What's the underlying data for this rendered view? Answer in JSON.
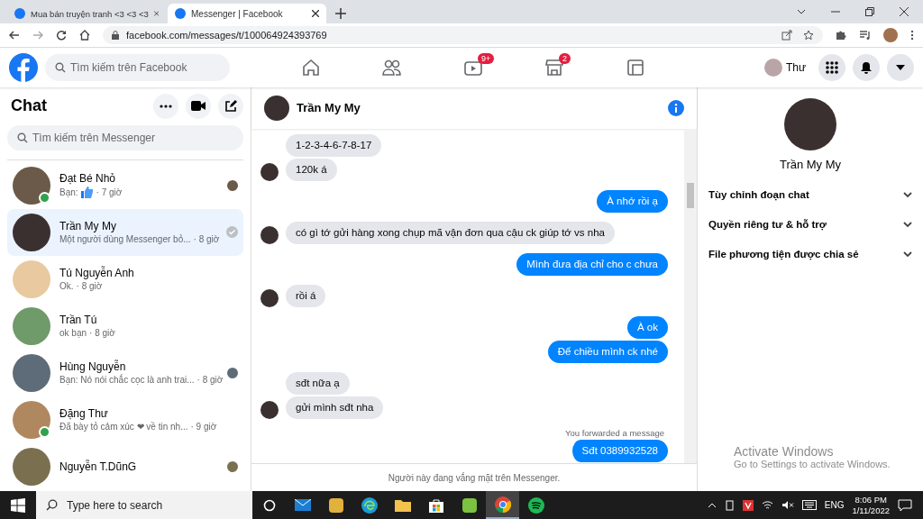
{
  "browser": {
    "tabs": [
      {
        "title": "Mua bán truyện tranh <3 <3 <3",
        "selected": false
      },
      {
        "title": "Messenger | Facebook",
        "selected": true
      }
    ],
    "url": "facebook.com/messages/t/100064924393769"
  },
  "header": {
    "search": {
      "placeholder": "Tìm kiếm trên Facebook"
    },
    "nav": [
      {
        "kind": "home"
      },
      {
        "kind": "friends"
      },
      {
        "kind": "video",
        "badge": "9+"
      },
      {
        "kind": "market",
        "badge": "2"
      },
      {
        "kind": "gaming"
      }
    ],
    "profile": "Thư"
  },
  "sidebar": {
    "title": "Chat",
    "search": {
      "placeholder": "Tìm kiếm trên Messenger"
    },
    "chats": [
      {
        "name": "Đạt Bé Nhỏ",
        "preview": "Bạn:",
        "thumbs_up": true,
        "time": "· 7 giờ",
        "online": true,
        "selected": false,
        "seen": true,
        "sent": false,
        "color": "#6b5a4a"
      },
      {
        "name": "Trần My My",
        "preview": "Một người dùng Messenger bỏ...",
        "thumbs_up": false,
        "time": "· 8 giờ",
        "online": false,
        "selected": true,
        "seen": false,
        "sent": true,
        "color": "#3b3030"
      },
      {
        "name": "Tú Nguyễn Anh",
        "preview": "Ok.",
        "thumbs_up": false,
        "time": "· 8 giờ",
        "online": false,
        "selected": false,
        "seen": false,
        "sent": false,
        "color": "#e8c9a0"
      },
      {
        "name": "Trần Tú",
        "preview": "ok bạn",
        "thumbs_up": false,
        "time": "· 8 giờ",
        "online": false,
        "selected": false,
        "seen": false,
        "sent": false,
        "color": "#6f9a6a"
      },
      {
        "name": "Hùng Nguyễn",
        "preview": "Bạn: Nó nói chắc cọc là anh trai...",
        "thumbs_up": false,
        "time": "· 8 giờ",
        "online": false,
        "selected": false,
        "seen": true,
        "sent": false,
        "color": "#5d6c78"
      },
      {
        "name": "Đặng Thư",
        "preview": "Đã bày tỏ cảm xúc ❤ về tin nh...",
        "thumbs_up": false,
        "time": "· 9 giờ",
        "online": true,
        "selected": false,
        "seen": false,
        "sent": false,
        "color": "#b08860"
      },
      {
        "name": "Nguyễn T.DũnG",
        "thumbs_up": false,
        "online": false,
        "selected": false,
        "seen": true,
        "sent": false,
        "color": "#7a7050"
      }
    ]
  },
  "conversation": {
    "name": "Trần My My",
    "messages": [
      {
        "kind": "in",
        "text": "1-2-3-4-6-7-8-17",
        "avatar": false
      },
      {
        "kind": "in",
        "text": "120k á",
        "avatar": true
      },
      {
        "kind": "out",
        "text": "À nhớ rồi ạ"
      },
      {
        "kind": "in",
        "text": "có gì tớ gửi hàng xong chụp mã vận đơn qua cậu ck giúp tớ vs nha",
        "avatar": true
      },
      {
        "kind": "out",
        "text": "Mình đưa địa chỉ cho c chưa"
      },
      {
        "kind": "in",
        "text": "rồi á",
        "avatar": true
      },
      {
        "kind": "out",
        "text": "À ok"
      },
      {
        "kind": "out",
        "text": "Để chiều mình ck nhé"
      },
      {
        "kind": "in",
        "text": "sđt nữa ạ",
        "avatar": false
      },
      {
        "kind": "in",
        "text": "gửi mình sđt nha",
        "avatar": true
      },
      {
        "kind": "note",
        "text": "You forwarded a message"
      },
      {
        "kind": "forward",
        "text": "Sđt 0389932528"
      }
    ],
    "footer": "Người này đang vắng mặt trên Messenger."
  },
  "details": {
    "name": "Trần My My",
    "sections": [
      {
        "label": "Tùy chỉnh đoạn chat",
        "expanded": false
      },
      {
        "label": "Quyền riêng tư & hỗ trợ",
        "expanded": false
      },
      {
        "label": "File phương tiện được chia sẻ",
        "expanded": false
      }
    ]
  },
  "activation": {
    "title": "Activate Windows",
    "subtitle": "Go to Settings to activate Windows."
  },
  "taskbar": {
    "search": {
      "placeholder": "Type here to search"
    },
    "apps": [
      {
        "kind": "cortana",
        "selected": false
      },
      {
        "kind": "mail",
        "selected": false
      },
      {
        "kind": "bee",
        "selected": false
      },
      {
        "kind": "edge",
        "selected": false
      },
      {
        "kind": "folder",
        "selected": false
      },
      {
        "kind": "store",
        "selected": false
      },
      {
        "kind": "green",
        "selected": false
      },
      {
        "kind": "chrome",
        "selected": true
      },
      {
        "kind": "spotify",
        "selected": false
      }
    ],
    "language": "ENG",
    "time": "8:06 PM",
    "date": "1/11/2022"
  }
}
